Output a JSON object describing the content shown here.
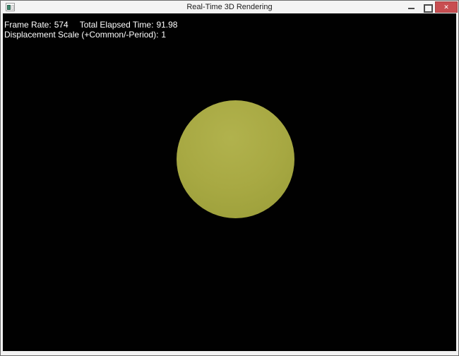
{
  "window": {
    "title": "Real-Time 3D Rendering"
  },
  "titlebar": {
    "app_icon": "app-window-icon",
    "minimize_icon": "minimize-icon",
    "maximize_icon": "maximize-icon",
    "close_icon": "close-icon",
    "close_glyph": "✕"
  },
  "hud": {
    "frame_rate_label": "Frame Rate:",
    "frame_rate": "574",
    "elapsed_label": "Total Elapsed Time:",
    "elapsed": "91.98",
    "scale_label": "Displacement Scale (+Common/-Period):",
    "scale_value": "1"
  },
  "scene": {
    "object": "sphere",
    "shading": "olive-yellow, lit from upper front"
  },
  "colors": {
    "frame_border": "#6e6e6e",
    "frame_fill": "#f2f2f2",
    "titlebar_bg": "#f4f4f4",
    "viewport_bg": "#010101",
    "close_red": "#c84e51",
    "icon_teal": "#3f8a70",
    "sphere_core": "#b1b24d",
    "sphere_mid": "#a8a943",
    "sphere_edge": "#9da03b",
    "sphere_rim": "#979a37",
    "hud_text": "#ffffff",
    "title_text": "#1c1c1c"
  }
}
